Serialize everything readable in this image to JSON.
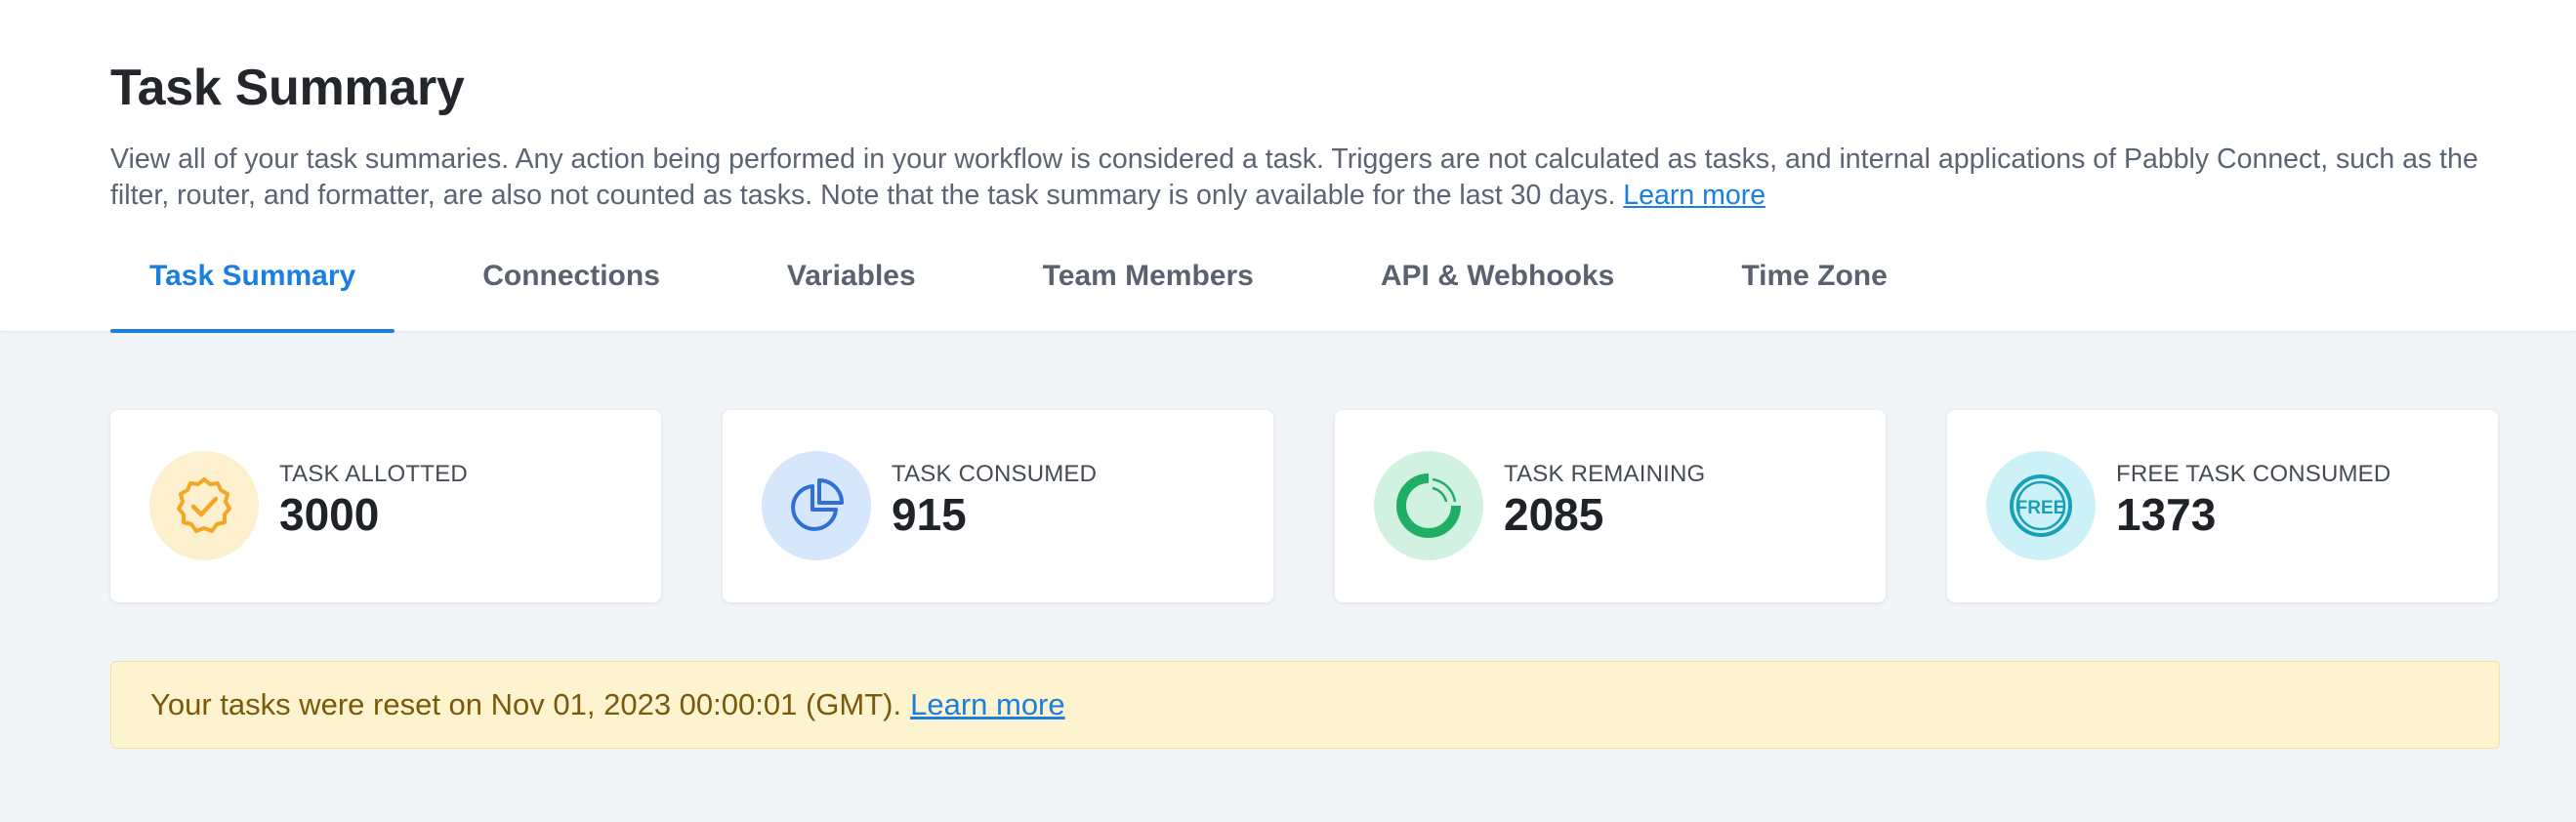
{
  "header": {
    "title": "Task Summary",
    "description": "View all of your task summaries. Any action being performed in your workflow is considered a task. Triggers are not calculated as tasks, and internal applications of Pabbly Connect, such as the filter, router, and formatter, are also not counted as tasks. Note that the task summary is only available for the last 30 days.",
    "learn_more": "Learn more"
  },
  "tabs": [
    {
      "label": "Task Summary",
      "active": true
    },
    {
      "label": "Connections",
      "active": false
    },
    {
      "label": "Variables",
      "active": false
    },
    {
      "label": "Team Members",
      "active": false
    },
    {
      "label": "API & Webhooks",
      "active": false
    },
    {
      "label": "Time Zone",
      "active": false
    }
  ],
  "cards": [
    {
      "label": "TASK ALLOTTED",
      "value": "3000",
      "icon": "badge-check-icon",
      "icon_color": "#f5a623",
      "icon_bg": "#fdf0cf"
    },
    {
      "label": "TASK CONSUMED",
      "value": "915",
      "icon": "pie-chart-icon",
      "icon_color": "#2f6fd6",
      "icon_bg": "#d6e6fb"
    },
    {
      "label": "TASK REMAINING",
      "value": "2085",
      "icon": "donut-icon",
      "icon_color": "#1fae63",
      "icon_bg": "#d2f2e1"
    },
    {
      "label": "FREE TASK CONSUMED",
      "value": "1373",
      "icon": "free-icon",
      "icon_color": "#1a9fb8",
      "icon_bg": "#ccf2f8"
    }
  ],
  "notice": {
    "text": "Your tasks were reset on Nov 01, 2023 00:00:01 (GMT).",
    "learn_more": "Learn more",
    "bg": "#fdf3cf"
  },
  "icons": {
    "free_text": "FREE"
  }
}
